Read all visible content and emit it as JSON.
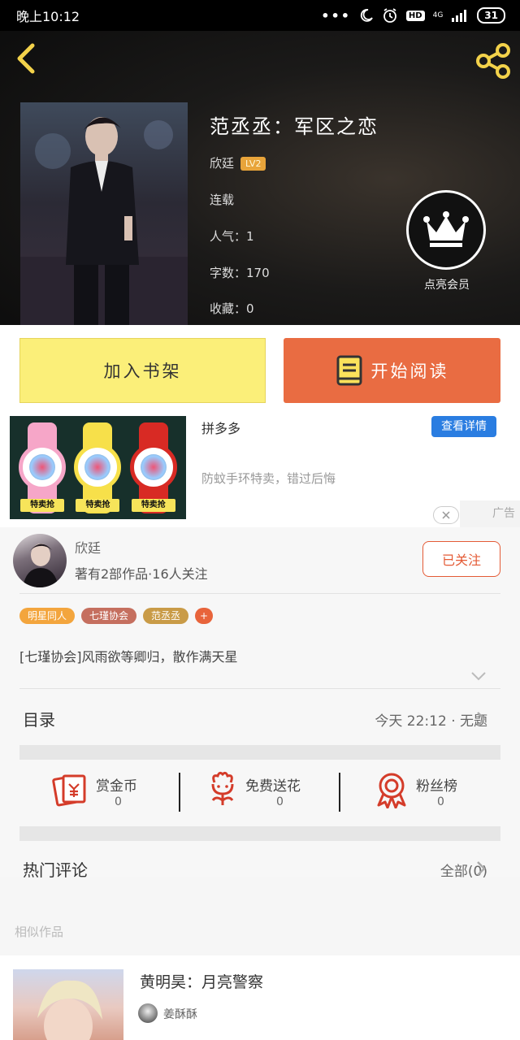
{
  "status_bar": {
    "time": "晚上10:12",
    "dots": "•••",
    "hd": "HD",
    "network": "4G",
    "battery": "31"
  },
  "book": {
    "title": "范丞丞：军区之恋",
    "author": "欣廷",
    "author_level": "LV2",
    "status": "连载",
    "popularity": "人气：1",
    "word_count": "字数：170",
    "favorites": "收藏：0"
  },
  "vip": {
    "label": "点亮会员"
  },
  "actions": {
    "add_shelf": "加入书架",
    "start_reading": "开始阅读"
  },
  "ad": {
    "name": "拼多多",
    "description": "防蚊手环特卖，错过后悔",
    "detail_button": "查看详情",
    "label": "广告",
    "product_tag": "特卖抢"
  },
  "author_card": {
    "name": "欣廷",
    "stats": "著有2部作品·16人关注",
    "follow_button": "已关注"
  },
  "tags": [
    {
      "label": "明星同人",
      "color": "#f3a53d"
    },
    {
      "label": "七瑾协会",
      "color": "#c56f5f"
    },
    {
      "label": "范丞丞",
      "color": "#c99b47"
    },
    {
      "label": "+",
      "color": "#e8643b"
    }
  ],
  "description": "[七瑾协会]风雨欲等卿归，散作满天星",
  "catalog": {
    "title": "目录",
    "latest": "今天 22:12 · 无题"
  },
  "stats": [
    {
      "label": "赏金币",
      "count": "0",
      "icon": "red-envelope-icon"
    },
    {
      "label": "免费送花",
      "count": "0",
      "icon": "flower-icon"
    },
    {
      "label": "粉丝榜",
      "count": "0",
      "icon": "medal-icon"
    }
  ],
  "comments": {
    "title": "热门评论",
    "all": "全部(0)"
  },
  "similar": {
    "title": "相似作品",
    "items": [
      {
        "title": "黄明昊：月亮警察",
        "author": "姜酥酥"
      }
    ]
  },
  "colors": {
    "accent_orange": "#e96c42",
    "shelf_yellow": "#fbef79",
    "follow_red": "#e45b36",
    "ad_blue": "#2a7de1"
  }
}
